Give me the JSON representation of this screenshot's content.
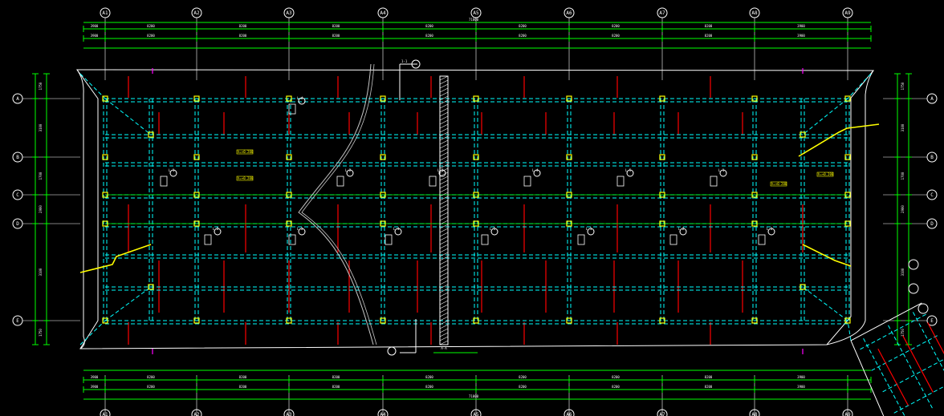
{
  "drawing": {
    "axis_labels_top": [
      "A1",
      "A2",
      "A3",
      "A4",
      "A5",
      "A6",
      "A7",
      "A8",
      "A9"
    ],
    "axis_labels_left": [
      "A",
      "B",
      "C",
      "D",
      "E"
    ],
    "top_dims_row1": [
      "3900",
      "8200",
      "8200",
      "8200",
      "8200",
      "8200",
      "8200",
      "8200",
      "3900"
    ],
    "top_dims_row2": [
      "3900",
      "8200",
      "8200",
      "8200",
      "8200",
      "8200",
      "8200",
      "8200",
      "3900"
    ],
    "top_total": "71800",
    "bottom_dims_row1": [
      "3900",
      "8200",
      "8200",
      "8200",
      "8200",
      "8200",
      "8200",
      "8200",
      "3900"
    ],
    "bottom_dims_row2": [
      "3900",
      "8200",
      "8200",
      "8200",
      "8200",
      "8200",
      "8200",
      "8200",
      "3900"
    ],
    "bottom_total": "71800",
    "left_dims": [
      "1750",
      "3100",
      "1700",
      "2900",
      "3100",
      "1750"
    ],
    "callouts": [
      "L-1",
      "L-2",
      "L-3",
      "L-4",
      "L-5"
    ],
    "yellow_tags": [
      "h=+0.200",
      "h=+0.200",
      "h=+0.200",
      "h=+0.200"
    ],
    "section_label": "1-1",
    "section_mark": "A-A",
    "colors": {
      "background": "#000000",
      "grid_line": "#00ffff",
      "column": "#ffff00",
      "dimension": "#00ff00",
      "rebar": "#ff0000",
      "outline": "#ffffff",
      "slab_hatch": "#ffffff"
    }
  }
}
